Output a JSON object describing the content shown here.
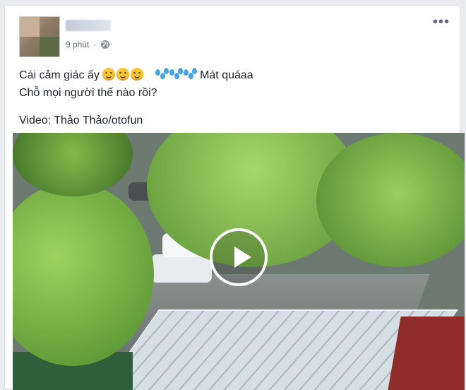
{
  "post": {
    "author_name": "",
    "timestamp": "9 phút",
    "privacy_icon": "globe-icon",
    "more_icon": "more-options-icon",
    "text": {
      "line1_prefix": "Cái cảm giác ấy",
      "line1_emojis": [
        "smiling-face-emoji",
        "smiling-face-emoji",
        "smiling-face-emoji"
      ],
      "line1_sweat": [
        "sweat-droplets-emoji",
        "sweat-droplets-emoji",
        "sweat-droplets-emoji"
      ],
      "line1_suffix": "Mát quáaa",
      "line2": "Chỗ mọi người thế nào rồi?",
      "credit": "Video: Thảo Thảo/otofun"
    },
    "video": {
      "play_icon": "play-icon",
      "scene": "rainy street view from above with trees and cars"
    }
  },
  "colors": {
    "background": "#e9ebee",
    "card": "#ffffff",
    "text": "#1d2129",
    "meta": "#616770",
    "foliage": "#7db84a"
  }
}
